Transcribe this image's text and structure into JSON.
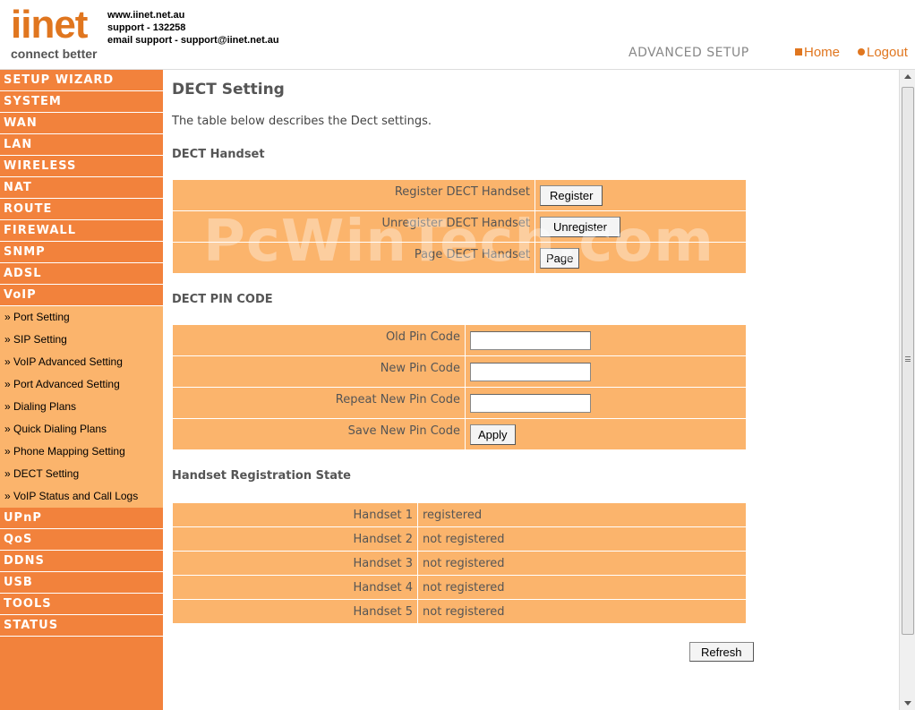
{
  "brand": {
    "logo_word": "iinet",
    "logo_tagline": "connect better",
    "contact": [
      "www.iinet.net.au",
      "support - 132258",
      "email support - support@iinet.net.au"
    ]
  },
  "header": {
    "section_label": "ADVANCED SETUP",
    "home_label": "Home",
    "logout_label": "Logout"
  },
  "sidebar": {
    "items_top": [
      "SETUP WIZARD",
      "SYSTEM",
      "WAN",
      "LAN",
      "WIRELESS",
      "NAT",
      "ROUTE",
      "FIREWALL",
      "SNMP",
      "ADSL",
      "VoIP"
    ],
    "voip_sub": [
      "» Port Setting",
      "» SIP Setting",
      "» VoIP Advanced Setting",
      "» Port Advanced Setting",
      "» Dialing Plans",
      "» Quick Dialing Plans",
      "» Phone Mapping Setting",
      "» DECT Setting",
      "» VoIP Status and Call Logs"
    ],
    "items_bottom": [
      "UPnP",
      "QoS",
      "DDNS",
      "USB",
      "TOOLS",
      "STATUS"
    ]
  },
  "main": {
    "title": "DECT Setting",
    "description": "The table below describes the Dect settings.",
    "watermark": "PcWinTech.com",
    "handset_section": {
      "title": "DECT Handset",
      "rows": [
        {
          "label": "Register DECT Handset",
          "button": "Register"
        },
        {
          "label": "Unregister DECT Handset",
          "button": "Unregister"
        },
        {
          "label": "Page DECT Handset",
          "button": "Page"
        }
      ]
    },
    "pin_section": {
      "title": "DECT PIN CODE",
      "old_label": "Old Pin Code",
      "old_value": "",
      "new_label": "New Pin Code",
      "new_value": "",
      "repeat_label": "Repeat New Pin Code",
      "repeat_value": "",
      "save_label": "Save New Pin Code",
      "apply_button": "Apply"
    },
    "state_section": {
      "title": "Handset Registration State",
      "rows": [
        {
          "handset": "Handset 1",
          "state": "registered"
        },
        {
          "handset": "Handset 2",
          "state": "not registered"
        },
        {
          "handset": "Handset 3",
          "state": "not registered"
        },
        {
          "handset": "Handset 4",
          "state": "not registered"
        },
        {
          "handset": "Handset 5",
          "state": "not registered"
        }
      ]
    },
    "refresh_button": "Refresh"
  },
  "colors": {
    "accent": "#e0761f",
    "sidebar_main": "#f2823c",
    "sidebar_sub": "#fbb46c",
    "table_bg": "#fbb46c"
  }
}
